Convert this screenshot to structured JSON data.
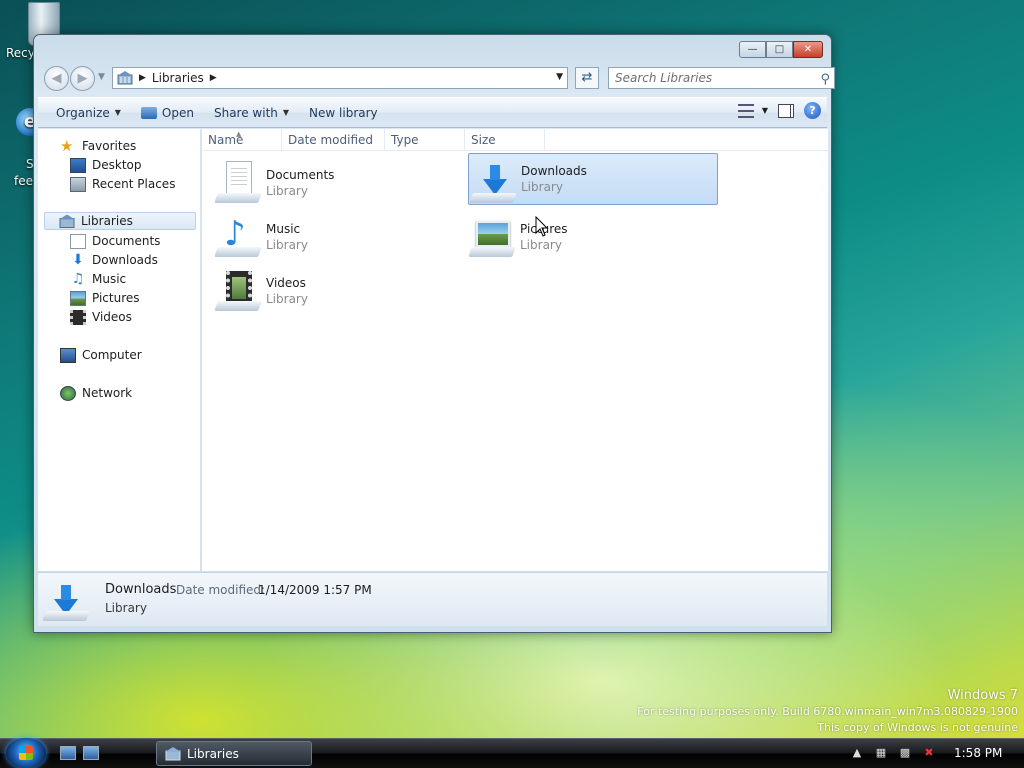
{
  "desktop": {
    "recycle_label": "Recy",
    "ie_line1": "S",
    "ie_line2": "feed"
  },
  "window": {
    "address": {
      "crumb": "Libraries"
    },
    "search": {
      "placeholder": "Search Libraries"
    },
    "toolbar": {
      "organize": "Organize",
      "open": "Open",
      "share_with": "Share with",
      "new_library": "New library"
    },
    "nav": {
      "favorites": "Favorites",
      "desktop": "Desktop",
      "recent_places": "Recent Places",
      "libraries": "Libraries",
      "documents": "Documents",
      "downloads": "Downloads",
      "music": "Music",
      "pictures": "Pictures",
      "videos": "Videos",
      "computer": "Computer",
      "network": "Network"
    },
    "columns": {
      "name": "Name",
      "date_modified": "Date modified",
      "type": "Type",
      "size": "Size"
    },
    "items": [
      {
        "name": "Documents",
        "kind": "Library",
        "icon": "documents-library-icon"
      },
      {
        "name": "Downloads",
        "kind": "Library",
        "icon": "downloads-library-icon"
      },
      {
        "name": "Music",
        "kind": "Library",
        "icon": "music-library-icon"
      },
      {
        "name": "Pictures",
        "kind": "Library",
        "icon": "pictures-library-icon"
      },
      {
        "name": "Videos",
        "kind": "Library",
        "icon": "videos-library-icon"
      }
    ],
    "details": {
      "name": "Downloads",
      "date_label": "Date modified:",
      "date_value": "1/14/2009 1:57 PM",
      "type": "Library"
    }
  },
  "branding": {
    "line1": "Windows 7",
    "line2": "For testing purposes only. Build 6780.winmain_win7m3.080829-1900",
    "line3": "This copy of Windows is not genuine"
  },
  "taskbar": {
    "task_label": "Libraries",
    "clock": "1:58 PM"
  },
  "colors": {
    "selection": "#c4dcf5",
    "accent": "#1c7ad6"
  }
}
